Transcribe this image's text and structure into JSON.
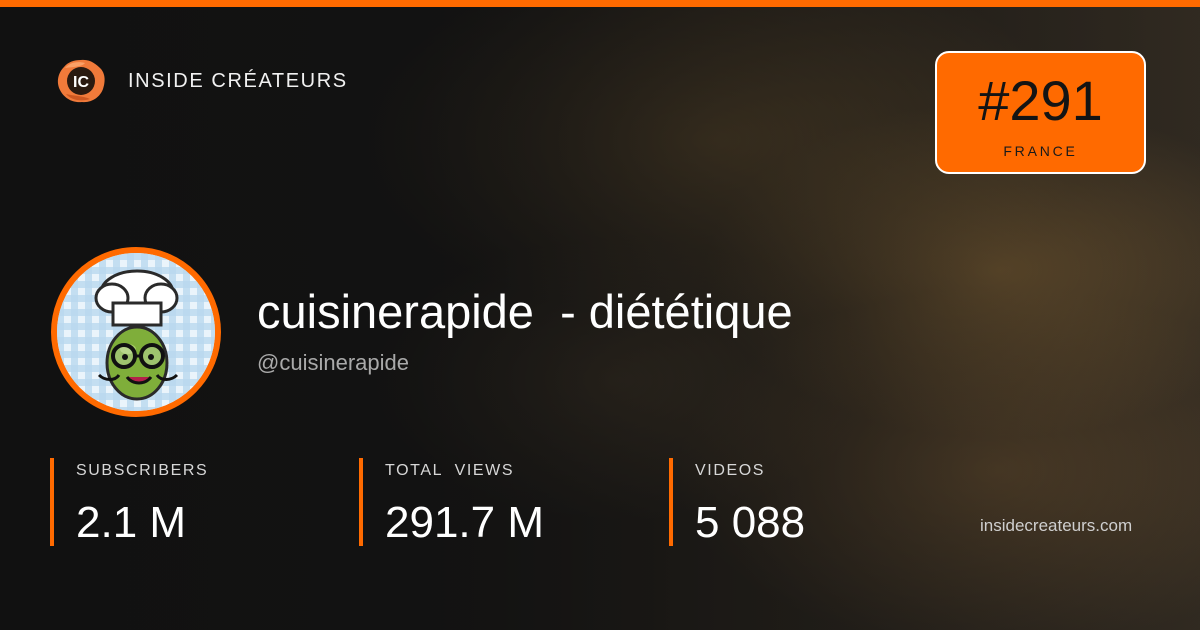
{
  "brand": {
    "name": "INSIDE CRÉATEURS",
    "logo_text": "IC",
    "logo_icon": "ic-logo-icon"
  },
  "rank": {
    "number": "#291",
    "country": "FRANCE"
  },
  "channel": {
    "title": "cuisinerapide  - diététique",
    "handle": "@cuisinerapide",
    "avatar_icon": "chef-olive-avatar-icon"
  },
  "stats": [
    {
      "label": "SUBSCRIBERS",
      "value": "2.1 M"
    },
    {
      "label": "TOTAL  VIEWS",
      "value": "291.7 M"
    },
    {
      "label": "VIDEOS",
      "value": "5 088"
    }
  ],
  "footer": {
    "site": "insidecreateurs.com"
  },
  "colors": {
    "accent": "#ff6a00",
    "background": "#111111",
    "text": "#ffffff",
    "muted": "#a9a9a9"
  }
}
